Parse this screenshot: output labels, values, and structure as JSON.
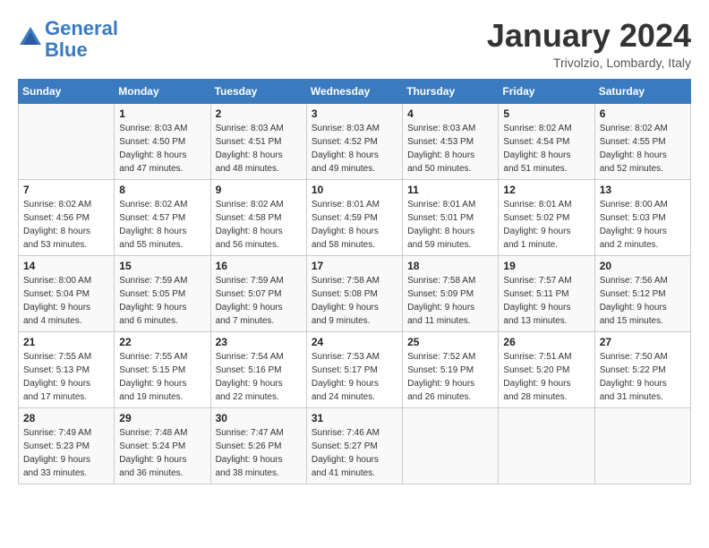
{
  "header": {
    "logo_line1": "General",
    "logo_line2": "Blue",
    "month_title": "January 2024",
    "location": "Trivolzio, Lombardy, Italy"
  },
  "weekdays": [
    "Sunday",
    "Monday",
    "Tuesday",
    "Wednesday",
    "Thursday",
    "Friday",
    "Saturday"
  ],
  "weeks": [
    [
      {
        "day": "",
        "info": ""
      },
      {
        "day": "1",
        "info": "Sunrise: 8:03 AM\nSunset: 4:50 PM\nDaylight: 8 hours\nand 47 minutes."
      },
      {
        "day": "2",
        "info": "Sunrise: 8:03 AM\nSunset: 4:51 PM\nDaylight: 8 hours\nand 48 minutes."
      },
      {
        "day": "3",
        "info": "Sunrise: 8:03 AM\nSunset: 4:52 PM\nDaylight: 8 hours\nand 49 minutes."
      },
      {
        "day": "4",
        "info": "Sunrise: 8:03 AM\nSunset: 4:53 PM\nDaylight: 8 hours\nand 50 minutes."
      },
      {
        "day": "5",
        "info": "Sunrise: 8:02 AM\nSunset: 4:54 PM\nDaylight: 8 hours\nand 51 minutes."
      },
      {
        "day": "6",
        "info": "Sunrise: 8:02 AM\nSunset: 4:55 PM\nDaylight: 8 hours\nand 52 minutes."
      }
    ],
    [
      {
        "day": "7",
        "info": "Sunrise: 8:02 AM\nSunset: 4:56 PM\nDaylight: 8 hours\nand 53 minutes."
      },
      {
        "day": "8",
        "info": "Sunrise: 8:02 AM\nSunset: 4:57 PM\nDaylight: 8 hours\nand 55 minutes."
      },
      {
        "day": "9",
        "info": "Sunrise: 8:02 AM\nSunset: 4:58 PM\nDaylight: 8 hours\nand 56 minutes."
      },
      {
        "day": "10",
        "info": "Sunrise: 8:01 AM\nSunset: 4:59 PM\nDaylight: 8 hours\nand 58 minutes."
      },
      {
        "day": "11",
        "info": "Sunrise: 8:01 AM\nSunset: 5:01 PM\nDaylight: 8 hours\nand 59 minutes."
      },
      {
        "day": "12",
        "info": "Sunrise: 8:01 AM\nSunset: 5:02 PM\nDaylight: 9 hours\nand 1 minute."
      },
      {
        "day": "13",
        "info": "Sunrise: 8:00 AM\nSunset: 5:03 PM\nDaylight: 9 hours\nand 2 minutes."
      }
    ],
    [
      {
        "day": "14",
        "info": "Sunrise: 8:00 AM\nSunset: 5:04 PM\nDaylight: 9 hours\nand 4 minutes."
      },
      {
        "day": "15",
        "info": "Sunrise: 7:59 AM\nSunset: 5:05 PM\nDaylight: 9 hours\nand 6 minutes."
      },
      {
        "day": "16",
        "info": "Sunrise: 7:59 AM\nSunset: 5:07 PM\nDaylight: 9 hours\nand 7 minutes."
      },
      {
        "day": "17",
        "info": "Sunrise: 7:58 AM\nSunset: 5:08 PM\nDaylight: 9 hours\nand 9 minutes."
      },
      {
        "day": "18",
        "info": "Sunrise: 7:58 AM\nSunset: 5:09 PM\nDaylight: 9 hours\nand 11 minutes."
      },
      {
        "day": "19",
        "info": "Sunrise: 7:57 AM\nSunset: 5:11 PM\nDaylight: 9 hours\nand 13 minutes."
      },
      {
        "day": "20",
        "info": "Sunrise: 7:56 AM\nSunset: 5:12 PM\nDaylight: 9 hours\nand 15 minutes."
      }
    ],
    [
      {
        "day": "21",
        "info": "Sunrise: 7:55 AM\nSunset: 5:13 PM\nDaylight: 9 hours\nand 17 minutes."
      },
      {
        "day": "22",
        "info": "Sunrise: 7:55 AM\nSunset: 5:15 PM\nDaylight: 9 hours\nand 19 minutes."
      },
      {
        "day": "23",
        "info": "Sunrise: 7:54 AM\nSunset: 5:16 PM\nDaylight: 9 hours\nand 22 minutes."
      },
      {
        "day": "24",
        "info": "Sunrise: 7:53 AM\nSunset: 5:17 PM\nDaylight: 9 hours\nand 24 minutes."
      },
      {
        "day": "25",
        "info": "Sunrise: 7:52 AM\nSunset: 5:19 PM\nDaylight: 9 hours\nand 26 minutes."
      },
      {
        "day": "26",
        "info": "Sunrise: 7:51 AM\nSunset: 5:20 PM\nDaylight: 9 hours\nand 28 minutes."
      },
      {
        "day": "27",
        "info": "Sunrise: 7:50 AM\nSunset: 5:22 PM\nDaylight: 9 hours\nand 31 minutes."
      }
    ],
    [
      {
        "day": "28",
        "info": "Sunrise: 7:49 AM\nSunset: 5:23 PM\nDaylight: 9 hours\nand 33 minutes."
      },
      {
        "day": "29",
        "info": "Sunrise: 7:48 AM\nSunset: 5:24 PM\nDaylight: 9 hours\nand 36 minutes."
      },
      {
        "day": "30",
        "info": "Sunrise: 7:47 AM\nSunset: 5:26 PM\nDaylight: 9 hours\nand 38 minutes."
      },
      {
        "day": "31",
        "info": "Sunrise: 7:46 AM\nSunset: 5:27 PM\nDaylight: 9 hours\nand 41 minutes."
      },
      {
        "day": "",
        "info": ""
      },
      {
        "day": "",
        "info": ""
      },
      {
        "day": "",
        "info": ""
      }
    ]
  ]
}
